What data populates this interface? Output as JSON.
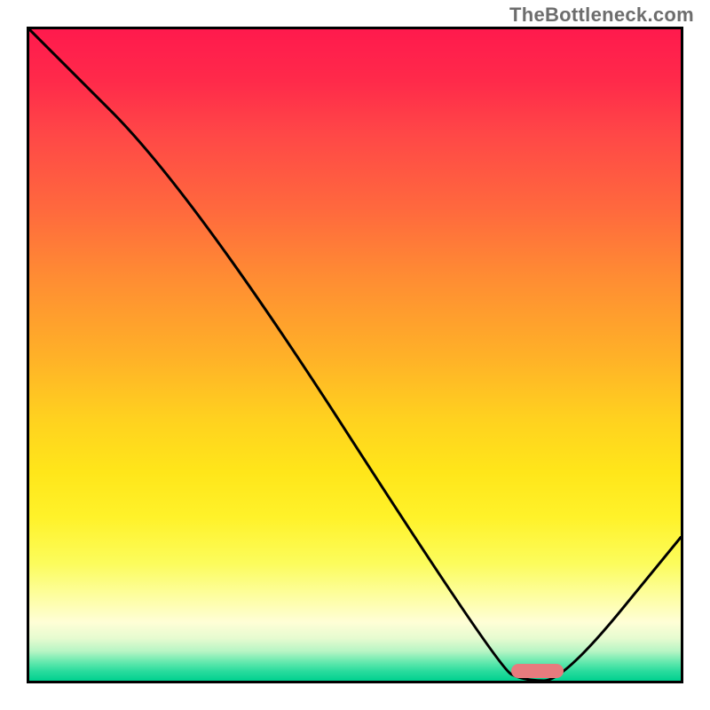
{
  "watermark": "TheBottleneck.com",
  "chart_data": {
    "type": "line",
    "title": "",
    "xlabel": "",
    "ylabel": "",
    "xlim": [
      0,
      100
    ],
    "ylim": [
      0,
      100
    ],
    "x": [
      0,
      25,
      72,
      76,
      82,
      100
    ],
    "values": [
      100,
      75,
      2,
      0,
      0,
      22
    ],
    "annotation": {
      "marker_x_range": [
        74,
        82
      ],
      "marker_y": 1.5
    },
    "gradient_stops": [
      {
        "pos": 0,
        "color": "#ff1a4d"
      },
      {
        "pos": 0.5,
        "color": "#ffb028"
      },
      {
        "pos": 0.82,
        "color": "#fcfc5c"
      },
      {
        "pos": 1.0,
        "color": "#00d18f"
      }
    ]
  },
  "frame": {
    "inner_width": 734,
    "inner_height": 734
  }
}
